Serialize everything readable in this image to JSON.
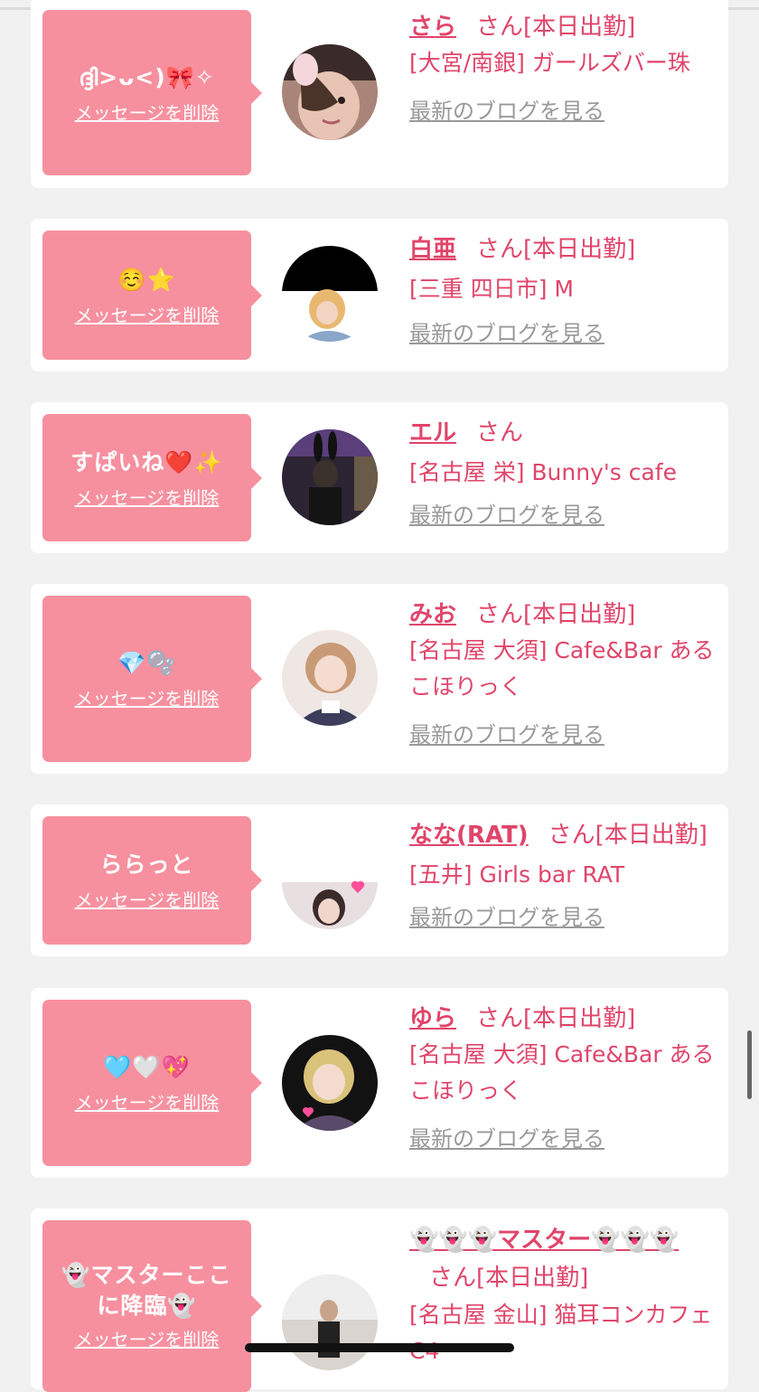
{
  "colors": {
    "page_bg": "#f1f1f1",
    "card_bg": "#ffffff",
    "bubble_pink": "#f6909f",
    "accent_text": "#e0456a",
    "blog_link_grey": "#999999"
  },
  "common": {
    "delete_label": "メッセージを削除",
    "blog_label": "最新のブログを見る",
    "san": "さん"
  },
  "items": [
    {
      "message": "ദ്ദി>ᴗ<)🎀✧",
      "name": "さら",
      "status": "[本日出勤]",
      "shop": "[大宮/南銀] ガールズバー珠",
      "avatar_icon": "girl-with-cat-filter-photo"
    },
    {
      "message": "☺️⭐",
      "name": "白亜",
      "status": "[本日出勤]",
      "shop": "[三重 四日市] M",
      "avatar_icon": "blonde-girl-photo-partially-covered"
    },
    {
      "message": "すぱいね❤️✨",
      "name": "エル",
      "status": "",
      "shop": "[名古屋 栄] Bunny's cafe",
      "avatar_icon": "bunny-girl-night-photo"
    },
    {
      "message": "💎🫧",
      "name": "みお",
      "status": "[本日出勤]",
      "shop": "[名古屋 大須] Cafe&Bar あるこほりっく",
      "avatar_icon": "maid-girl-photo"
    },
    {
      "message": "ららっと",
      "name": "なな(RAT)",
      "status": "[本日出勤]",
      "shop": "[五井] Girls bar RAT",
      "avatar_icon": "girl-with-hearts-photo"
    },
    {
      "message": "🩵🤍💖",
      "name": "ゆら",
      "status": "[本日出勤]",
      "shop": "[名古屋 大須] Cafe&Bar あるこほりっく",
      "avatar_icon": "blonde-girl-with-hearts-photo"
    },
    {
      "message": "👻マスターここに降臨👻",
      "name": "👻👻👻マスター👻👻👻",
      "status": "[本日出勤]",
      "shop": "[名古屋 金山] 猫耳コンカフェ C4",
      "avatar_icon": "master-person-photo"
    }
  ]
}
